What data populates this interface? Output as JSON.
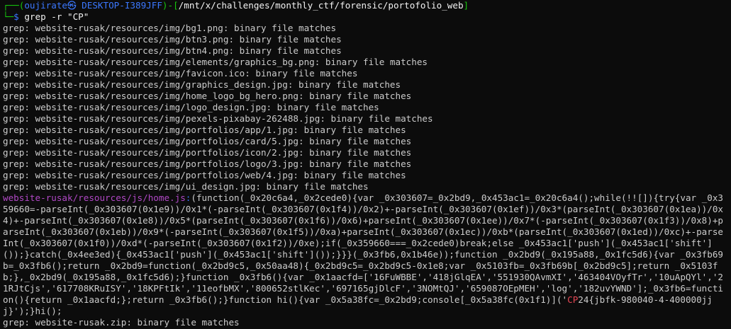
{
  "prompt": {
    "corner_top": "┌──(",
    "user_host": "oujirate㉿ DESKTOP-I389JFF",
    "mid": ")-[",
    "path": "/mnt/x/challenges/monthly_ctf/forensic/portofolio_web",
    "close": "]",
    "corner_bottom": "└─",
    "dollar": "$ ",
    "command": "grep -r \"CP\""
  },
  "binary_lines": [
    "grep: website-rusak/resources/img/bg1.png: binary file matches",
    "grep: website-rusak/resources/img/btn3.png: binary file matches",
    "grep: website-rusak/resources/img/btn4.png: binary file matches",
    "grep: website-rusak/resources/img/elements/graphics_bg.png: binary file matches",
    "grep: website-rusak/resources/img/favicon.ico: binary file matches",
    "grep: website-rusak/resources/img/graphics_design.jpg: binary file matches",
    "grep: website-rusak/resources/img/home_logo_bg_hero.png: binary file matches",
    "grep: website-rusak/resources/img/logo_design.jpg: binary file matches",
    "grep: website-rusak/resources/img/pexels-pixabay-262488.jpg: binary file matches",
    "grep: website-rusak/resources/img/portfolios/app/1.jpg: binary file matches",
    "grep: website-rusak/resources/img/portfolios/card/5.jpg: binary file matches",
    "grep: website-rusak/resources/img/portfolios/icon/2.jpg: binary file matches",
    "grep: website-rusak/resources/img/portfolios/logo/3.jpg: binary file matches",
    "grep: website-rusak/resources/img/portfolios/web/4.jpg: binary file matches",
    "grep: website-rusak/resources/img/ui_design.jpg: binary file matches"
  ],
  "js_match": {
    "filename": "website-rusak/resources/js/home.js",
    "separator": ":",
    "code_before": "(function(_0x20c6a4,_0x2cede0){var _0x303607=_0x2bd9,_0x453ac1=_0x20c6a4();while(!![]){try{var _0x359660=-parseInt(_0x303607(0x1e9))/0x1*(-parseInt(_0x303607(0x1f4))/0x2)+-parseInt(_0x303607(0x1ef))/0x3*(parseInt(_0x303607(0x1ea))/0x4)+-parseInt(_0x303607(0x1e8))/0x5*(parseInt(_0x303607(0x1f6))/0x6)+parseInt(_0x303607(0x1ee))/0x7*(-parseInt(_0x303607(0x1f3))/0x8)+parseInt(_0x303607(0x1eb))/0x9*(-parseInt(_0x303607(0x1f5))/0xa)+parseInt(_0x303607(0x1ec))/0xb*(parseInt(_0x303607(0x1ed))/0xc)+-parseInt(_0x303607(0x1f0))/0xd*(-parseInt(_0x303607(0x1f2))/0xe);if(_0x359660===_0x2cede0)break;else _0x453ac1['push'](_0x453ac1['shift']());}catch(_0x4ee3ed){_0x453ac1['push'](_0x453ac1['shift']());}}}(_0x3fb6,0x1b46e));function _0x2bd9(_0x195a88,_0x1fc5d6){var _0x3fb69b=_0x3fb6();return _0x2bd9=function(_0x2bd9c5,_0x50aa48){_0x2bd9c5=_0x2bd9c5-0x1e8;var _0x5103fb=_0x3fb69b[_0x2bd9c5];return _0x5103fb;},_0x2bd9(_0x195a88,_0x1fc5d6);}function _0x3fb6(){var _0x1aacfd=['16FuWBBE','418jGlqEA','551930QAvmXI','463404VOyfTr','10uApQYl','21RJtCjs','617708KRuISY','18KPFtIk','11eofbMX','800652stlKec','697165gjDlcF','3NOMtQJ','659087OEpMEH','log','182uvYWND'];_0x3fb6=function(){return _0x1aacfd;};return _0x3fb6();}function hi(){var _0x5a38fc=_0x2bd9;console[_0x5a38fc(0x1f1)]('",
    "highlight": "CP",
    "code_after": "24{jbfk-980040-4-400000jjj}');}hi();"
  },
  "last_line": "grep: website-rusak.zip: binary file matches"
}
